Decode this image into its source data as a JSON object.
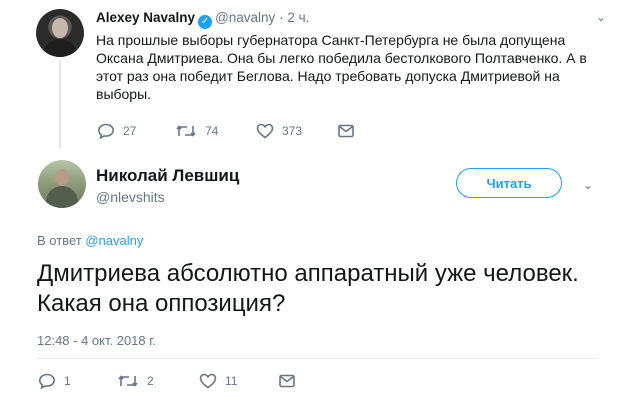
{
  "quoted_tweet": {
    "author_name": "Alexey Navalny",
    "handle": "@navalny",
    "separator": "·",
    "time": "2 ч.",
    "text": "На прошлые выборы губернатора Санкт-Петербурга не была допущена Оксана Дмитриева. Она бы легко победила бестолкового Полтавченко. А в этот раз она победит Беглова. Надо требовать допуска Дмитриевой на выборы.",
    "replies": "27",
    "retweets": "74",
    "likes": "373",
    "verified": true
  },
  "main_tweet": {
    "author_name": "Николай Левшиц",
    "handle": "@nlevshits",
    "follow_label": "Читать",
    "reply_prefix": "В ответ",
    "reply_to": "@navalny",
    "text": "Дмитриева абсолютно аппаратный уже человек. Какая она оппозиция?",
    "timestamp": "12:48 - 4 окт. 2018 г.",
    "replies": "1",
    "retweets": "2",
    "likes": "11"
  },
  "colors": {
    "accent": "#1da1f2",
    "muted": "#657786",
    "text": "#14171a"
  },
  "icons": [
    "reply-icon",
    "retweet-icon",
    "like-icon",
    "message-icon",
    "chevron-down-icon",
    "verified-icon"
  ]
}
